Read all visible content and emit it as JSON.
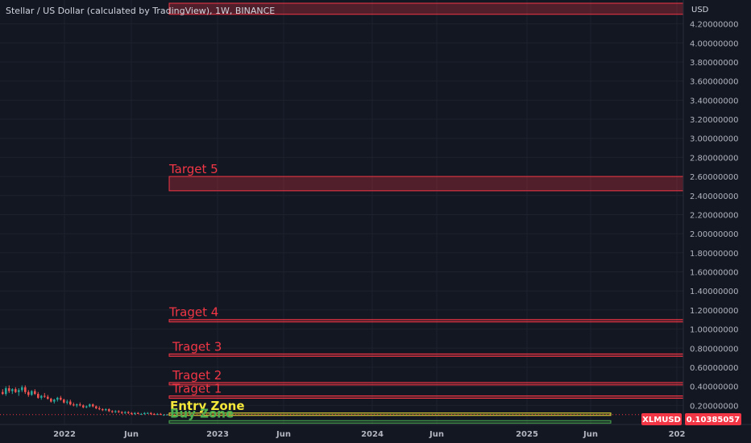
{
  "chart_data": {
    "type": "candlestick",
    "title": "Stellar / US Dollar (calculated by TradingView), 1W, BINANCE",
    "y_unit": "USD",
    "y_ticks": [
      0.2,
      0.4,
      0.6,
      0.8,
      1.0,
      1.2,
      1.4,
      1.6,
      1.8,
      2.0,
      2.2,
      2.4,
      2.6,
      2.8,
      3.0,
      3.2,
      3.4,
      3.6,
      3.8,
      4.0,
      4.2
    ],
    "ylim": [
      0.0,
      4.45
    ],
    "x_ticks": [
      "2022",
      "Jun",
      "2023",
      "Jun",
      "2024",
      "Jun",
      "2025",
      "Jun",
      "202"
    ],
    "grid": true,
    "price": {
      "symbol": "XLMUSD",
      "value": "0.10385057",
      "y": 0.10385057
    },
    "zones": [
      {
        "label": "",
        "y_bottom": 4.3,
        "y_top": 4.65,
        "color": "#f23645",
        "style": "box"
      },
      {
        "label": "Target 5",
        "y_bottom": 2.45,
        "y_top": 2.6,
        "color": "#f23645",
        "style": "box"
      },
      {
        "label": "Traget 4",
        "y_bottom": 1.08,
        "y_top": 1.1,
        "color": "#f23645",
        "style": "box"
      },
      {
        "label": "Traget 3",
        "y_bottom": 0.72,
        "y_top": 0.74,
        "color": "#f23645",
        "style": "box"
      },
      {
        "label": "Traget 2",
        "y_bottom": 0.42,
        "y_top": 0.44,
        "color": "#f23645",
        "style": "box"
      },
      {
        "label": "Traget 1",
        "y_bottom": 0.28,
        "y_top": 0.3,
        "color": "#f23645",
        "style": "box"
      },
      {
        "label": "Entry Zone",
        "y_bottom": 0.1,
        "y_top": 0.12,
        "color": "#f5e83a",
        "style": "box"
      },
      {
        "label": "Buy Zone",
        "y_bottom": 0.02,
        "y_top": 0.04,
        "color": "#4caf50",
        "style": "box"
      }
    ],
    "candles": [
      {
        "o": 0.34,
        "h": 0.37,
        "l": 0.31,
        "c": 0.32
      },
      {
        "o": 0.32,
        "h": 0.4,
        "l": 0.3,
        "c": 0.38
      },
      {
        "o": 0.38,
        "h": 0.41,
        "l": 0.33,
        "c": 0.35
      },
      {
        "o": 0.35,
        "h": 0.38,
        "l": 0.32,
        "c": 0.37
      },
      {
        "o": 0.37,
        "h": 0.39,
        "l": 0.33,
        "c": 0.34
      },
      {
        "o": 0.34,
        "h": 0.38,
        "l": 0.3,
        "c": 0.36
      },
      {
        "o": 0.36,
        "h": 0.41,
        "l": 0.34,
        "c": 0.39
      },
      {
        "o": 0.39,
        "h": 0.41,
        "l": 0.32,
        "c": 0.34
      },
      {
        "o": 0.34,
        "h": 0.36,
        "l": 0.29,
        "c": 0.31
      },
      {
        "o": 0.31,
        "h": 0.36,
        "l": 0.3,
        "c": 0.35
      },
      {
        "o": 0.35,
        "h": 0.37,
        "l": 0.31,
        "c": 0.32
      },
      {
        "o": 0.32,
        "h": 0.34,
        "l": 0.27,
        "c": 0.28
      },
      {
        "o": 0.28,
        "h": 0.31,
        "l": 0.26,
        "c": 0.3
      },
      {
        "o": 0.3,
        "h": 0.33,
        "l": 0.28,
        "c": 0.29
      },
      {
        "o": 0.29,
        "h": 0.31,
        "l": 0.26,
        "c": 0.27
      },
      {
        "o": 0.27,
        "h": 0.28,
        "l": 0.23,
        "c": 0.24
      },
      {
        "o": 0.24,
        "h": 0.27,
        "l": 0.22,
        "c": 0.26
      },
      {
        "o": 0.26,
        "h": 0.29,
        "l": 0.24,
        "c": 0.28
      },
      {
        "o": 0.28,
        "h": 0.3,
        "l": 0.25,
        "c": 0.26
      },
      {
        "o": 0.26,
        "h": 0.27,
        "l": 0.22,
        "c": 0.23
      },
      {
        "o": 0.23,
        "h": 0.26,
        "l": 0.21,
        "c": 0.24
      },
      {
        "o": 0.24,
        "h": 0.26,
        "l": 0.2,
        "c": 0.21
      },
      {
        "o": 0.21,
        "h": 0.23,
        "l": 0.19,
        "c": 0.2
      },
      {
        "o": 0.2,
        "h": 0.22,
        "l": 0.18,
        "c": 0.21
      },
      {
        "o": 0.21,
        "h": 0.23,
        "l": 0.19,
        "c": 0.2
      },
      {
        "o": 0.2,
        "h": 0.21,
        "l": 0.17,
        "c": 0.18
      },
      {
        "o": 0.18,
        "h": 0.2,
        "l": 0.17,
        "c": 0.19
      },
      {
        "o": 0.19,
        "h": 0.22,
        "l": 0.18,
        "c": 0.21
      },
      {
        "o": 0.21,
        "h": 0.22,
        "l": 0.18,
        "c": 0.19
      },
      {
        "o": 0.19,
        "h": 0.2,
        "l": 0.16,
        "c": 0.17
      },
      {
        "o": 0.17,
        "h": 0.19,
        "l": 0.15,
        "c": 0.16
      },
      {
        "o": 0.16,
        "h": 0.17,
        "l": 0.14,
        "c": 0.15
      },
      {
        "o": 0.15,
        "h": 0.17,
        "l": 0.14,
        "c": 0.16
      },
      {
        "o": 0.16,
        "h": 0.17,
        "l": 0.13,
        "c": 0.14
      },
      {
        "o": 0.14,
        "h": 0.15,
        "l": 0.12,
        "c": 0.13
      },
      {
        "o": 0.13,
        "h": 0.15,
        "l": 0.12,
        "c": 0.14
      },
      {
        "o": 0.14,
        "h": 0.15,
        "l": 0.12,
        "c": 0.13
      },
      {
        "o": 0.13,
        "h": 0.14,
        "l": 0.11,
        "c": 0.12
      },
      {
        "o": 0.12,
        "h": 0.14,
        "l": 0.11,
        "c": 0.13
      },
      {
        "o": 0.13,
        "h": 0.14,
        "l": 0.11,
        "c": 0.12
      },
      {
        "o": 0.12,
        "h": 0.13,
        "l": 0.1,
        "c": 0.11
      },
      {
        "o": 0.11,
        "h": 0.13,
        "l": 0.1,
        "c": 0.12
      },
      {
        "o": 0.12,
        "h": 0.13,
        "l": 0.11,
        "c": 0.11
      },
      {
        "o": 0.11,
        "h": 0.12,
        "l": 0.1,
        "c": 0.11
      },
      {
        "o": 0.11,
        "h": 0.13,
        "l": 0.1,
        "c": 0.12
      },
      {
        "o": 0.12,
        "h": 0.13,
        "l": 0.11,
        "c": 0.12
      },
      {
        "o": 0.12,
        "h": 0.13,
        "l": 0.1,
        "c": 0.11
      },
      {
        "o": 0.11,
        "h": 0.12,
        "l": 0.1,
        "c": 0.1
      },
      {
        "o": 0.1,
        "h": 0.12,
        "l": 0.1,
        "c": 0.11
      },
      {
        "o": 0.11,
        "h": 0.12,
        "l": 0.1,
        "c": 0.1
      },
      {
        "o": 0.1,
        "h": 0.11,
        "l": 0.1,
        "c": 0.1
      },
      {
        "o": 0.1,
        "h": 0.11,
        "l": 0.1,
        "c": 0.104
      }
    ],
    "colors": {
      "background": "#131722",
      "grid": "#1e222d",
      "up": "#26a69a",
      "down": "#ef5350",
      "text": "#b2b5be",
      "target": "#f23645",
      "entry": "#f5e83a",
      "buy": "#4caf50",
      "price_tag": "#f23645"
    }
  }
}
